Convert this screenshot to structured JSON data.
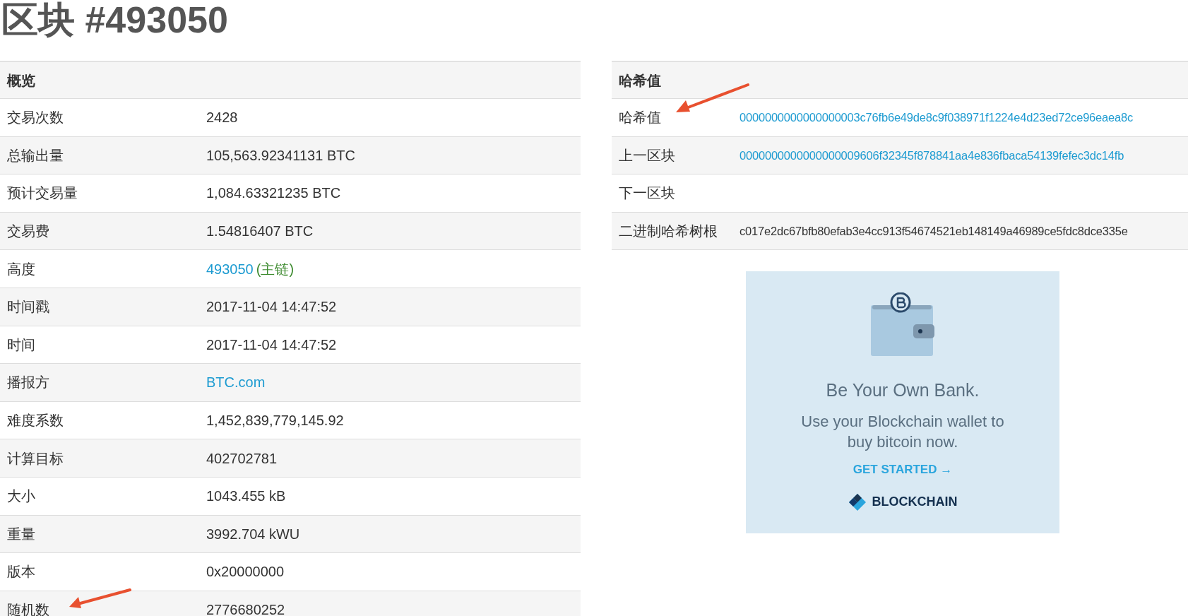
{
  "title": "区块 #493050",
  "summary": {
    "heading": "概览",
    "rows": [
      {
        "label": "交易次数",
        "kind": "text",
        "value": "2428"
      },
      {
        "label": "总输出量",
        "kind": "text",
        "value": "105,563.92341131 BTC"
      },
      {
        "label": "预计交易量",
        "kind": "text",
        "value": "1,084.63321235 BTC"
      },
      {
        "label": "交易费",
        "kind": "text",
        "value": "1.54816407 BTC"
      },
      {
        "label": "高度",
        "kind": "chain",
        "value": "493050",
        "note": "(主链)"
      },
      {
        "label": "时间戳",
        "kind": "text",
        "value": "2017-11-04 14:47:52"
      },
      {
        "label": "时间",
        "kind": "text",
        "value": "2017-11-04 14:47:52"
      },
      {
        "label": "播报方",
        "kind": "link",
        "value": "BTC.com"
      },
      {
        "label": "难度系数",
        "kind": "text",
        "value": "1,452,839,779,145.92"
      },
      {
        "label": "计算目标",
        "kind": "text",
        "value": "402702781"
      },
      {
        "label": "大小",
        "kind": "text",
        "value": "1043.455 kB"
      },
      {
        "label": "重量",
        "kind": "text",
        "value": "3992.704 kWU"
      },
      {
        "label": "版本",
        "kind": "text",
        "value": "0x20000000"
      },
      {
        "label": "随机数",
        "kind": "text",
        "value": "2776680252"
      }
    ]
  },
  "hashes": {
    "heading": "哈希值",
    "rows": [
      {
        "label": "哈希值",
        "kind": "link",
        "value": "0000000000000000003c76fb6e49de8c9f038971f1224e4d23ed72ce96eaea8c"
      },
      {
        "label": "上一区块",
        "kind": "link",
        "value": "0000000000000000009606f32345f878841aa4e836fbaca54139fefec3dc14fb"
      },
      {
        "label": "下一区块",
        "kind": "empty"
      },
      {
        "label": "二进制哈希树根",
        "kind": "text",
        "value": "c017e2dc67bfb80efab3e4cc913f54674521eb148149a46989ce5fdc8dce335e"
      }
    ]
  },
  "ad": {
    "headline": "Be Your Own Bank.",
    "body": "Use your Blockchain wallet to buy bitcoin now.",
    "cta": "GET STARTED →",
    "brand": "BLOCKCHAIN"
  }
}
